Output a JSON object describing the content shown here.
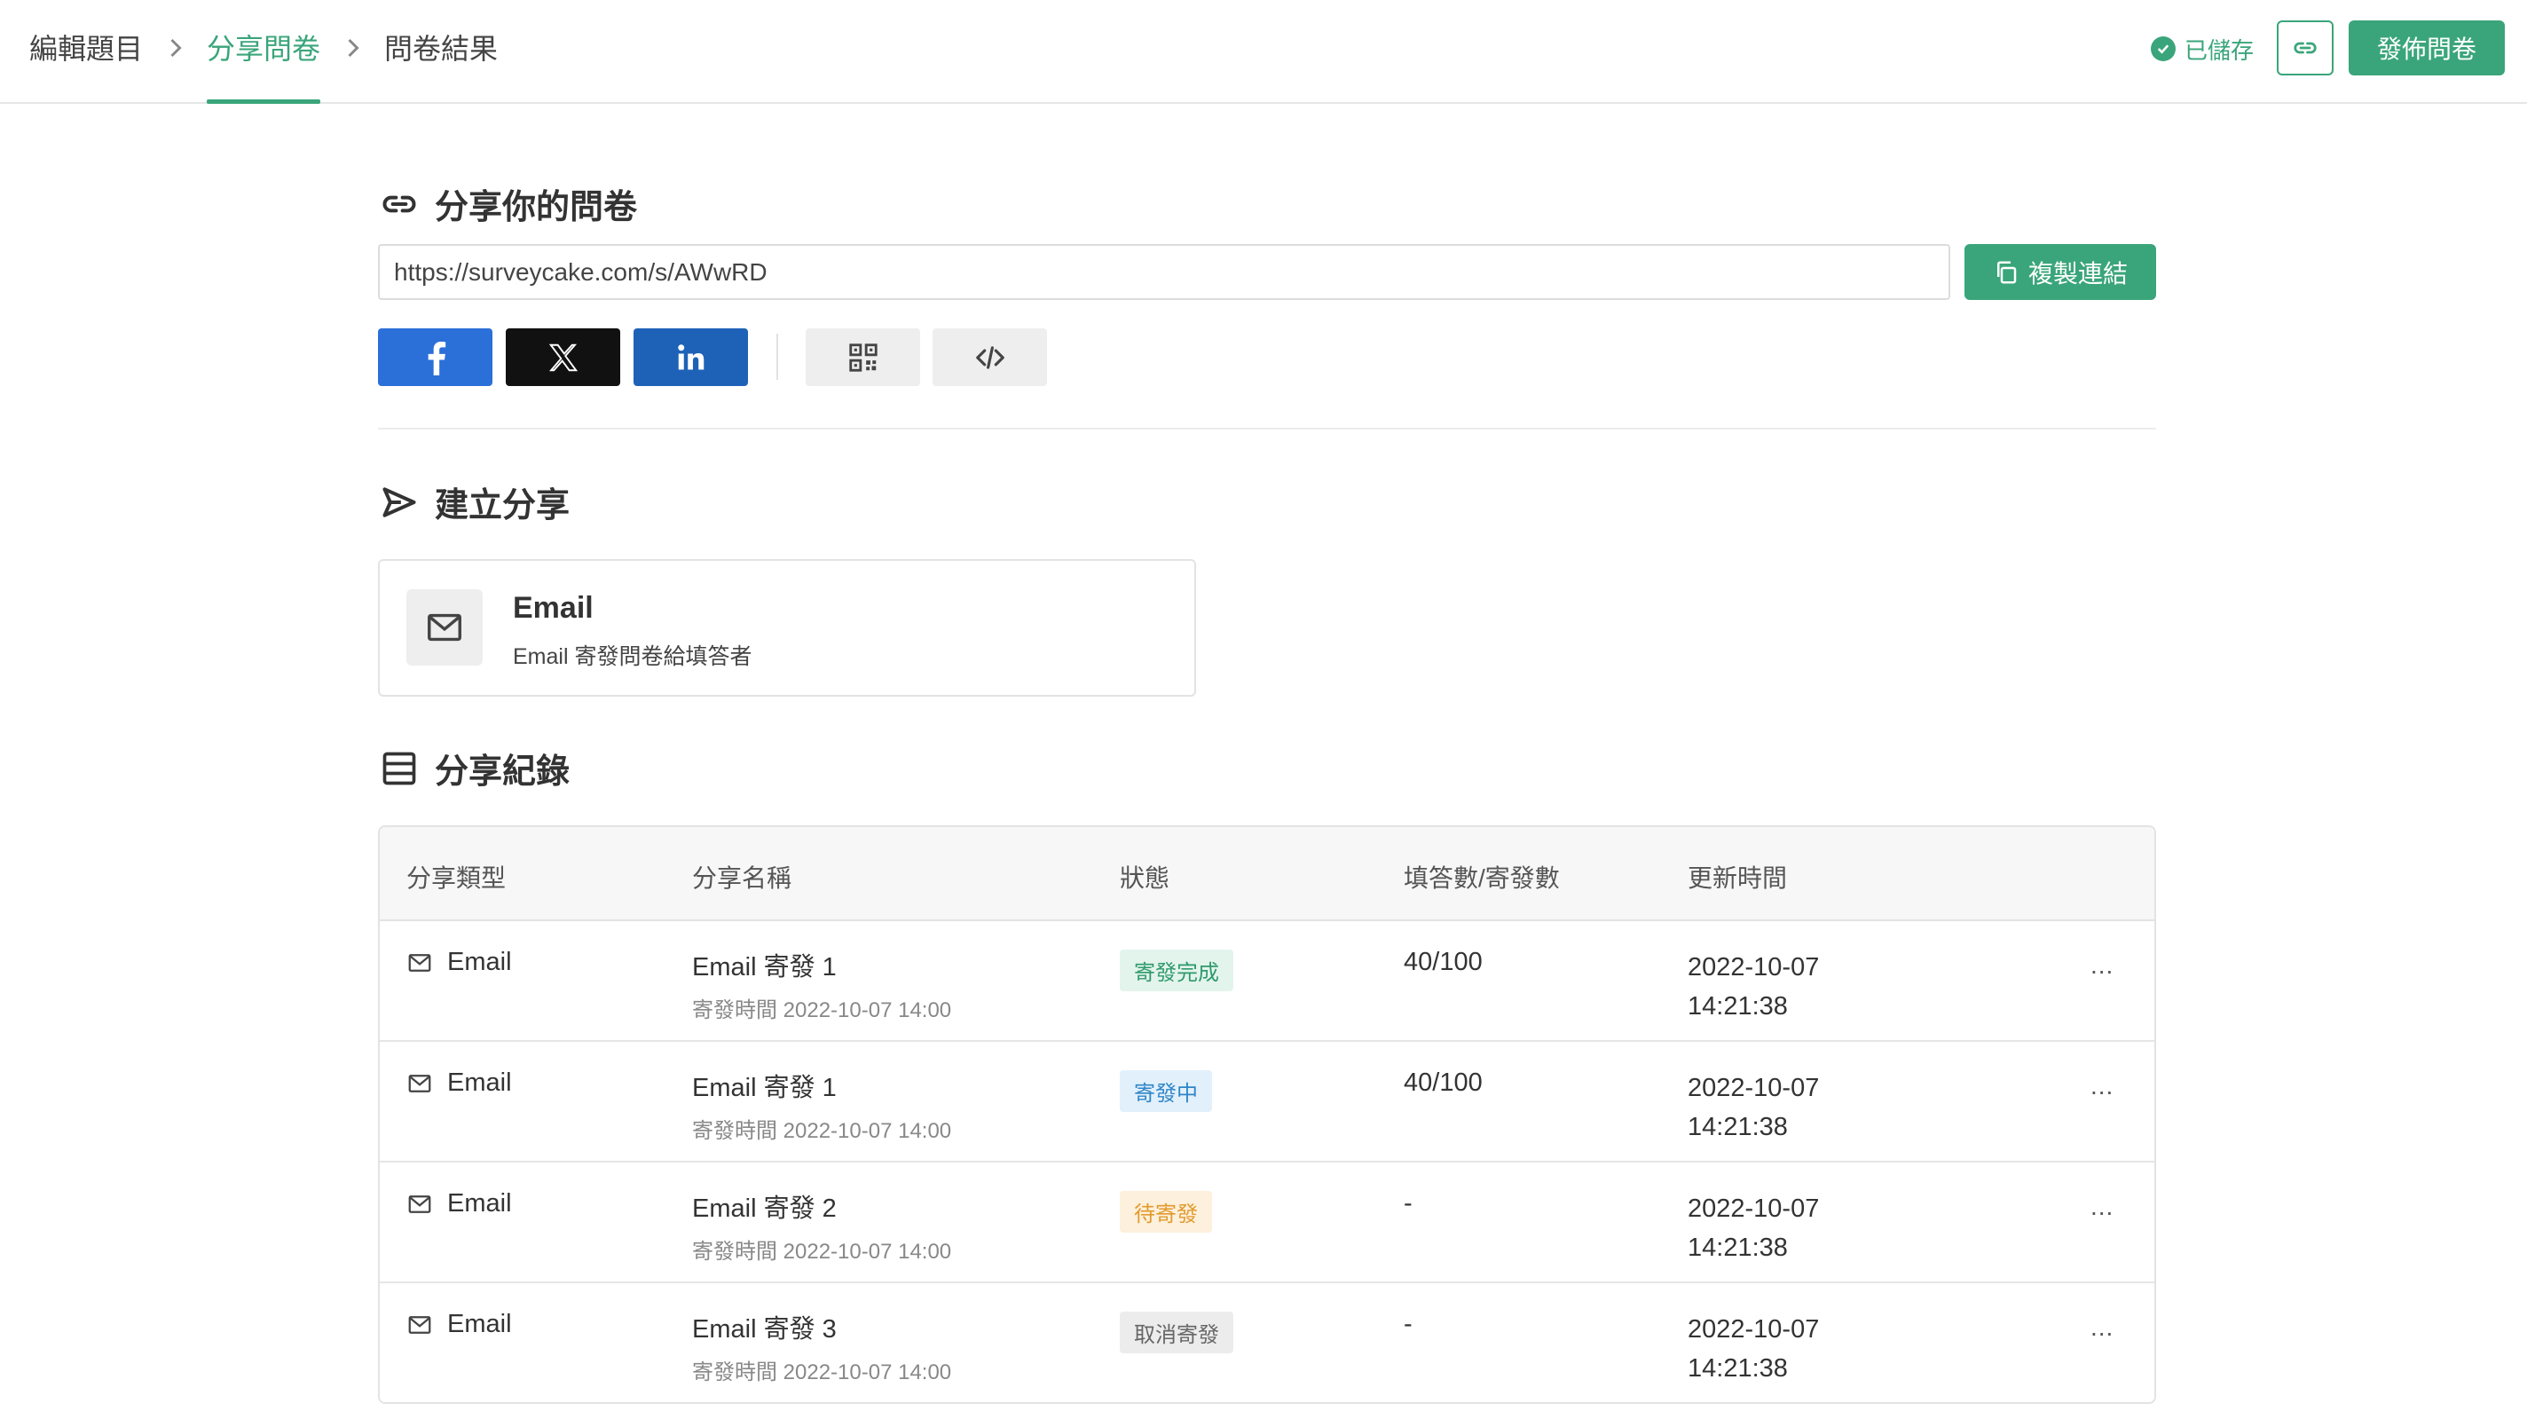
{
  "breadcrumb": {
    "items": [
      "編輯題目",
      "分享問卷",
      "問卷結果"
    ],
    "active_index": 1
  },
  "header": {
    "saved_label": "已儲存",
    "publish_label": "發佈問卷"
  },
  "share": {
    "title": "分享你的問卷",
    "url": "https://surveycake.com/s/AWwRD",
    "copy_label": "複製連結"
  },
  "create": {
    "title": "建立分享",
    "card_title": "Email",
    "card_subtitle": "Email 寄發問卷給填答者"
  },
  "records": {
    "title": "分享紀錄",
    "columns": [
      "分享類型",
      "分享名稱",
      "狀態",
      "填答數/寄發數",
      "更新時間"
    ],
    "rows": [
      {
        "type": "Email",
        "name": "Email 寄發 1",
        "send_time": "寄發時間 2022-10-07  14:00",
        "status": "寄發完成",
        "count": "40/100",
        "date": "2022-10-07",
        "time": "14:21:38",
        "more": "..."
      },
      {
        "type": "Email",
        "name": "Email 寄發 1",
        "send_time": "寄發時間 2022-10-07  14:00",
        "status": "寄發中",
        "count": "40/100",
        "date": "2022-10-07",
        "time": "14:21:38",
        "more": "..."
      },
      {
        "type": "Email",
        "name": "Email 寄發 2",
        "send_time": "寄發時間 2022-10-07  14:00",
        "status": "待寄發",
        "count": "-",
        "date": "2022-10-07",
        "time": "14:21:38",
        "more": "..."
      },
      {
        "type": "Email",
        "name": "Email 寄發 3",
        "send_time": "寄發時間 2022-10-07  14:00",
        "status": "取消寄發",
        "count": "-",
        "date": "2022-10-07",
        "time": "14:21:38",
        "more": "..."
      }
    ]
  },
  "colors": {
    "accent": "#3aa57a",
    "status_done_bg": "#e3f4ec",
    "status_done_fg": "#2f9a6c",
    "status_sending_bg": "#e2f0fb",
    "status_sending_fg": "#2f86c8",
    "status_pending_bg": "#fdf0dc",
    "status_pending_fg": "#e29a2c",
    "status_cancel_bg": "#ececec",
    "status_cancel_fg": "#666666"
  },
  "icons": {
    "share_title": "link-icon",
    "create_title": "send-icon",
    "records_title": "list-icon",
    "email": "mail-icon",
    "saved": "check-circle-icon"
  }
}
